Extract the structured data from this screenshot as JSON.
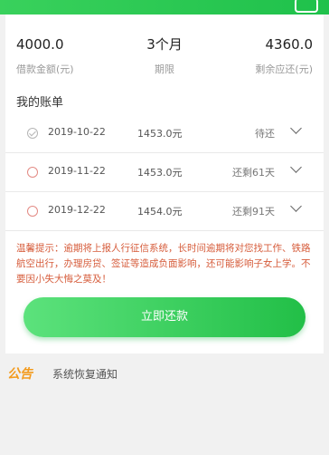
{
  "summary": {
    "loan_amount": "4000.0",
    "loan_amount_label": "借款金额(元)",
    "term": "3个月",
    "term_label": "期限",
    "remaining": "4360.0",
    "remaining_label": "剩余应还(元)"
  },
  "bills": {
    "title": "我的账单",
    "rows": [
      {
        "date": "2019-10-22",
        "amount": "1453.0元",
        "status": "待还",
        "checked": true
      },
      {
        "date": "2019-11-22",
        "amount": "1453.0元",
        "status": "还剩61天",
        "checked": false
      },
      {
        "date": "2019-12-22",
        "amount": "1454.0元",
        "status": "还剩91天",
        "checked": false
      }
    ]
  },
  "notice": "温馨提示：逾期将上报人行征信系统，长时间逾期将对您找工作、铁路航空出行，办理房贷、签证等造成负面影响，还可能影响子女上学。不要因小失大悔之莫及！",
  "repay_button": "立即还款",
  "announcement": {
    "tag": "公告",
    "text": "系统恢复通知"
  },
  "colors": {
    "accent": "#22bf47",
    "notice": "#d65c3b",
    "announce_tag": "#f39a1c"
  }
}
